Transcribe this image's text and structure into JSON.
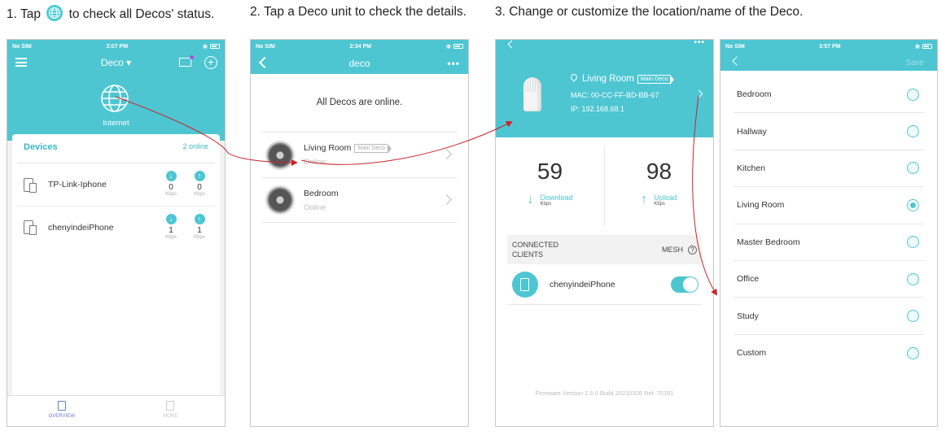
{
  "steps": {
    "step1_before": "1. Tap",
    "step1_after": "to check all Decos' status.",
    "step2": "2. Tap a Deco unit to check the details.",
    "step3": "3. Change or customize the location/name of the Deco."
  },
  "phone1": {
    "status": {
      "carrier": "No SIM",
      "time": "2:07 PM"
    },
    "title": "Deco ▾",
    "internet_label": "Internet",
    "devices_title": "Devices",
    "online_count": "2 online",
    "devices": [
      {
        "name": "TP-Link-Iphone",
        "down": "0",
        "up": "0",
        "unit": "Kbps"
      },
      {
        "name": "chenyindeiPhone",
        "down": "1",
        "up": "1",
        "unit": "Kbps"
      }
    ],
    "tabs": {
      "overview": "OVERVIEW",
      "more": "MORE"
    }
  },
  "phone2": {
    "status": {
      "carrier": "No SIM",
      "time": "2:34 PM"
    },
    "title": "deco",
    "dots": "•••",
    "message": "All Decos are online.",
    "units": [
      {
        "name": "Living Room",
        "tag": "Main Deco",
        "status": "Online"
      },
      {
        "name": "Bedroom",
        "status": "Online"
      }
    ]
  },
  "phone3": {
    "dots": "•••",
    "location": "Living Room",
    "tag": "Main Deco",
    "mac": "MAC: 00-CC-FF-BD-BB-67",
    "ip": "IP: 192.168.68.1",
    "download": {
      "value": "59",
      "label": "Download",
      "unit": "Kbps"
    },
    "upload": {
      "value": "98",
      "label": "Upload",
      "unit": "Kbps"
    },
    "clients_title_1": "CONNECTED",
    "clients_title_2": "CLIENTS",
    "mesh": "MESH",
    "client_name": "chenyindeiPhone",
    "firmware": "Firmware Version 1.5.0 Build 20210326 Rel. 70781"
  },
  "phone4": {
    "status": {
      "carrier": "No SIM",
      "time": "3:57 PM"
    },
    "save": "Save",
    "options": [
      "Bedroom",
      "Hallway",
      "Kitchen",
      "Living Room",
      "Master Bedroom",
      "Office",
      "Study",
      "Custom"
    ],
    "selected": "Living Room"
  },
  "colors": {
    "accent": "#4dc6d2",
    "arrow": "#c8242b"
  }
}
